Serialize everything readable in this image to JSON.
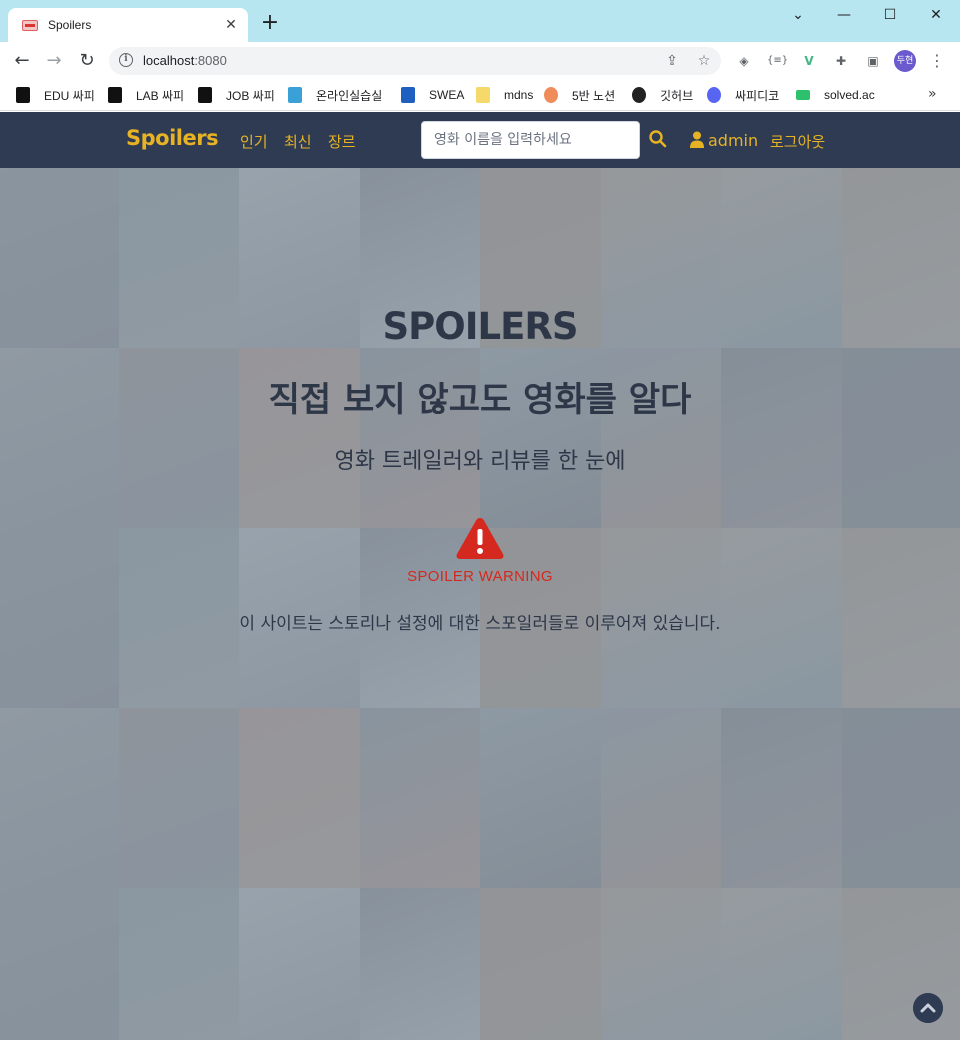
{
  "browser": {
    "tab_title": "Spoilers",
    "url_host": "localhost",
    "url_port": ":8080",
    "avatar_text": "두현",
    "bookmarks": [
      "EDU 싸피",
      "LAB 싸피",
      "JOB 싸피",
      "온라인실습실",
      "SWEA",
      "mdns",
      "5반 노션",
      "깃허브",
      "싸피디코",
      "solved.ac"
    ],
    "icons": [
      "back-arrow-icon",
      "forward-arrow-icon",
      "reload-icon",
      "info-icon",
      "share-icon",
      "star-icon",
      "extensions-icon",
      "sidebar-icon",
      "menu-dots-icon"
    ]
  },
  "nav": {
    "brand": "Spoilers",
    "links": [
      "인기",
      "최신",
      "장르"
    ],
    "search_placeholder": "영화 이름을 입력하세요",
    "user": "admin",
    "logout": "로그아웃",
    "accent_color": "#e7b324",
    "bg_color": "#2e3b52"
  },
  "hero": {
    "logo_text": "SPOILERS",
    "title": "직접 보지 않고도 영화를 알다",
    "subtitle": "영화 트레일러와 리뷰를 한 눈에",
    "warning_label": "SPOILER WARNING",
    "warning_text": "이 사이트는 스토리나 설정에 대한 스포일러들로 이루어져 있습니다.",
    "warning_color": "#d5291f"
  }
}
